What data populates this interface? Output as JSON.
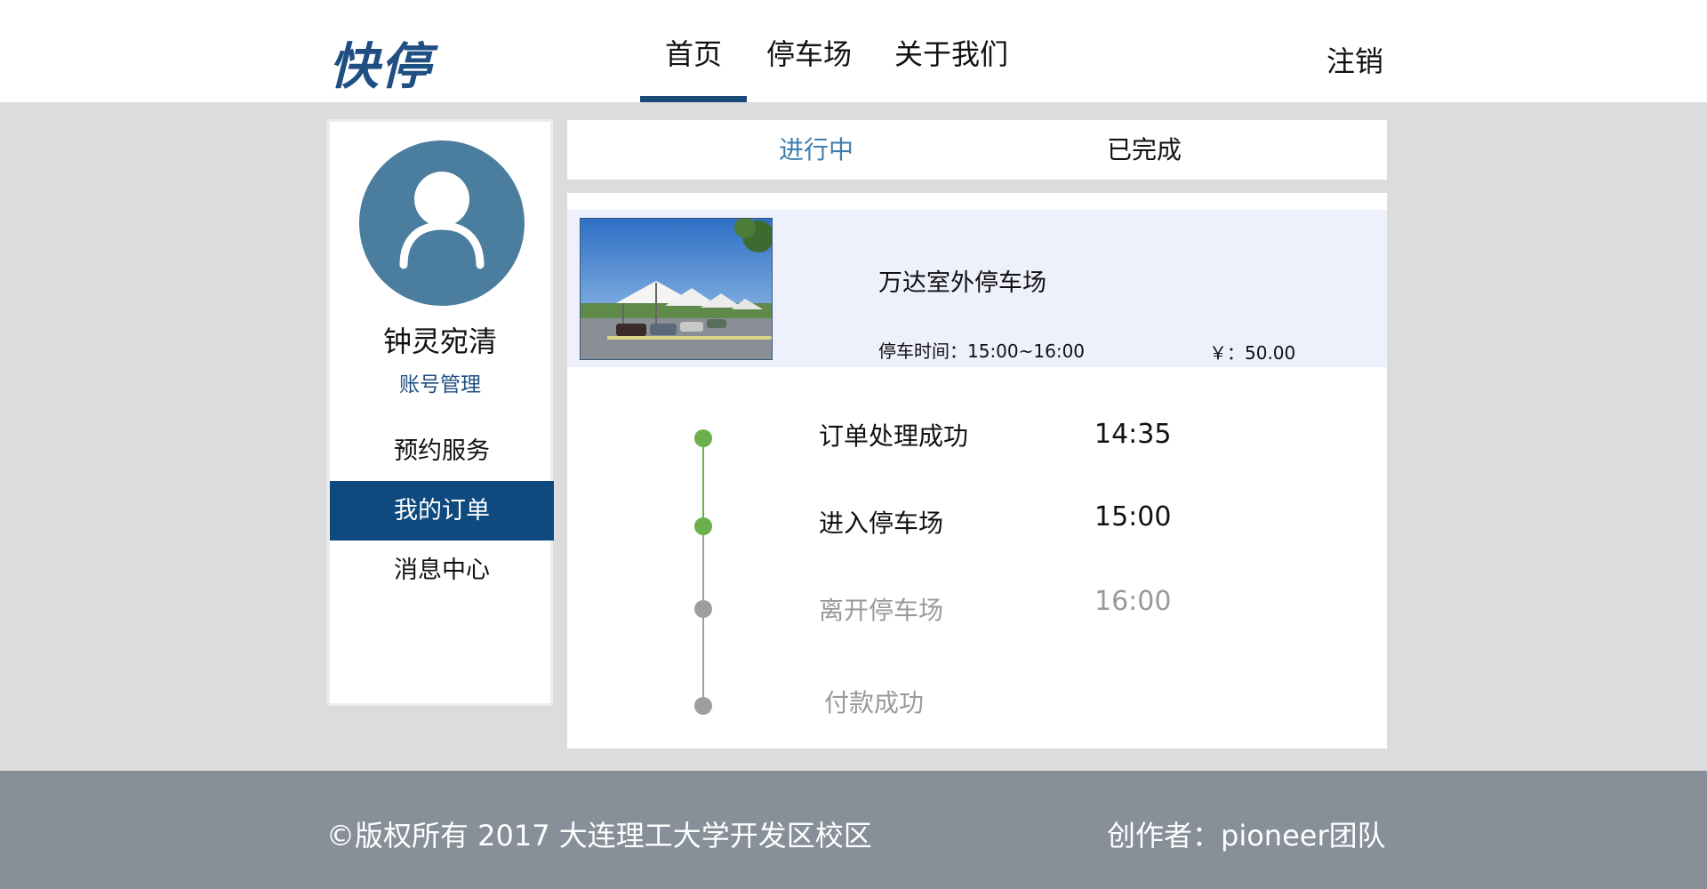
{
  "header": {
    "logo_text": "快停",
    "nav": [
      {
        "label": "首页",
        "active": true
      },
      {
        "label": "停车场",
        "active": false
      },
      {
        "label": "关于我们",
        "active": false
      }
    ],
    "logout_label": "注销"
  },
  "sidebar": {
    "avatar_icon": "user-avatar-icon",
    "username": "钟灵宛清",
    "account_link": "账号管理",
    "menu": [
      {
        "label": "预约服务",
        "active": false
      },
      {
        "label": "我的订单",
        "active": true
      },
      {
        "label": "消息中心",
        "active": false
      }
    ]
  },
  "tabs": [
    {
      "label": "进行中",
      "active": true
    },
    {
      "label": "已完成",
      "active": false
    }
  ],
  "order": {
    "lot_name": "万达室外停车场",
    "park_time": "停车时间：15:00~16:00",
    "price": "￥：50.00"
  },
  "timeline": [
    {
      "label": "订单处理成功",
      "time": "14:35",
      "status": "done"
    },
    {
      "label": "进入停车场",
      "time": "15:00",
      "status": "done"
    },
    {
      "label": "离开停车场",
      "time": "16:00",
      "status": "pending"
    },
    {
      "label": "付款成功",
      "time": "",
      "status": "pending"
    }
  ],
  "footer": {
    "copyright": "©版权所有  2017  大连理工大学开发区校区",
    "author": "创作者：pioneer团队"
  },
  "colors": {
    "brand": "#0e4a7e",
    "accent_text": "#3f7fb0",
    "timeline_done": "#6ab04c",
    "timeline_pending": "#9e9e9e",
    "footer_bg": "#878f99"
  }
}
